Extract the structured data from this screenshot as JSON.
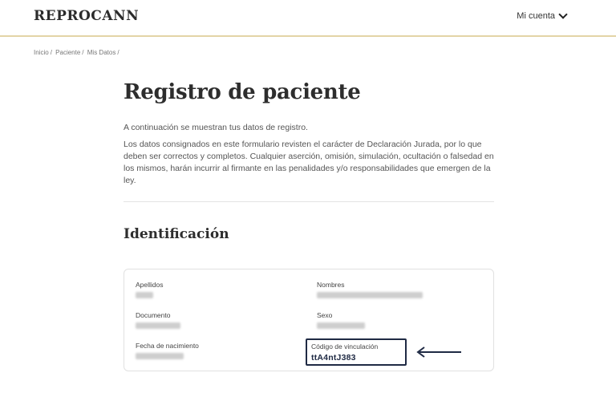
{
  "header": {
    "brand": "REPROCANN",
    "account_label": "Mi cuenta"
  },
  "breadcrumb": {
    "items": [
      "Inicio",
      "Paciente",
      "Mis Datos"
    ],
    "separator": "/"
  },
  "main": {
    "title": "Registro de paciente",
    "intro": "A continuación se muestran tus datos de registro.",
    "disclaimer": "Los datos consignados en este formulario revisten el carácter de Declaración Jurada, por lo que deben ser correctos y completos. Cualquier aserción, omisión, simulación, ocultación o falsedad en los mismos, harán incurrir al firmante en las penalidades y/o responsabilidades que emergen de la ley.",
    "section_title": "Identificación"
  },
  "identificacion": {
    "apellidos_label": "Apellidos",
    "nombres_label": "Nombres",
    "documento_label": "Documento",
    "sexo_label": "Sexo",
    "fecha_label": "Fecha de nacimiento",
    "codigo_label": "Código de vinculación",
    "codigo_value": "ttA4ntJ383"
  },
  "colors": {
    "accent_line": "#e3d4a6",
    "highlight_box": "#1f2a44"
  },
  "icons": {
    "account_chevron": "chevron-down-icon",
    "annotation_arrow": "arrow-left-icon"
  }
}
